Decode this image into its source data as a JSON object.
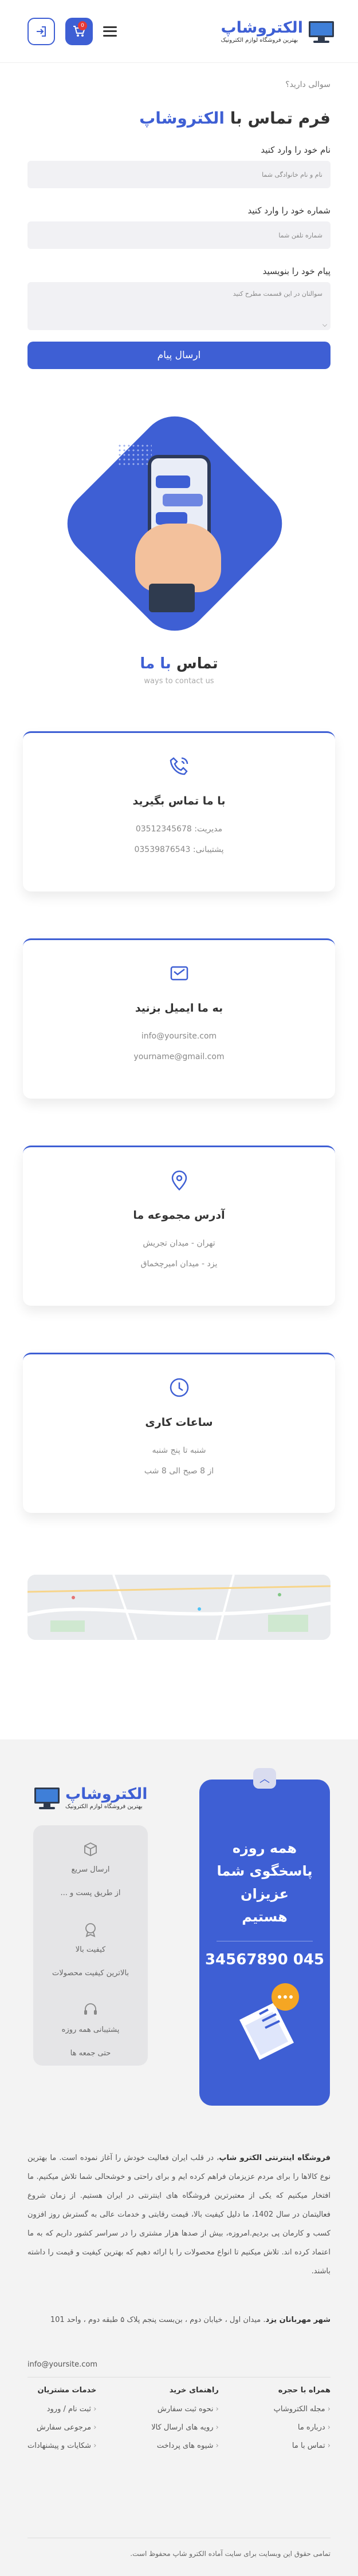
{
  "header": {
    "logo_name": "الکتروشاپ",
    "logo_tagline": "بهترین فروشگاه لوازم الکترونیک",
    "cart_count": "0"
  },
  "form": {
    "question_link": "سوالی دارید؟",
    "title_prefix": "فرم تماس با",
    "title_accent": "الکتروشاپ",
    "name_label": "نام خود را وارد کنید",
    "name_placeholder": "نام و نام خانوادگی شما",
    "phone_label": "شماره خود را وارد کنید",
    "phone_placeholder": "شماره تلفن شما",
    "message_label": "پیام خود را بنویسید",
    "message_placeholder": "سوالتان در این قسمت مطرح کنید",
    "submit_label": "ارسال پیام"
  },
  "contact": {
    "title_prefix": "تماس",
    "title_accent": "با ما",
    "subtitle": "ways to contact us",
    "cards": [
      {
        "icon": "phone-icon",
        "title": "با ما تماس بگیرید",
        "lines": [
          "مدیریت: 03512345678",
          "پشتیبانی: 03539876543"
        ]
      },
      {
        "icon": "email-icon",
        "title": "به ما ایمیل بزنید",
        "lines": [
          "info@yoursite.com",
          "yourname@gmail.com"
        ]
      },
      {
        "icon": "location-icon",
        "title": "آدرس مجموعه ما",
        "lines": [
          "تهران - میدان تجریش",
          "یزد - میدان امیرچخماق"
        ]
      },
      {
        "icon": "clock-icon",
        "title": "ساعات کاری",
        "lines": [
          "شنبه تا پنج شنبه",
          "از 8 صبح الی 8 شب"
        ]
      }
    ]
  },
  "footer": {
    "logo_name": "الکتروشاپ",
    "logo_tagline": "بهترین فروشگاه لوازم الکترونیک",
    "headline": "همه روزه پاسخگوی شما عزیزان هستیم",
    "phone": "045 34567890",
    "features": [
      {
        "icon": "shipping-icon",
        "title": "ارسال سریع",
        "desc": "از طریق پست و ..."
      },
      {
        "icon": "quality-icon",
        "title": "کیفیت بالا",
        "desc": "بالاترین کیفیت محصولات"
      },
      {
        "icon": "support-icon",
        "title": "پشتیبانی همه روزه",
        "desc": "حتی جمعه ها"
      }
    ],
    "about_bold": "فروشگاه اینترنتی الکترو شاپ",
    "about_text": "، در قلب ایران فعالیت خودش را آغاز نموده است. ما بهترین نوع کالاها را برای مردم عزیزمان فراهم کرده ایم و برای راحتی و خوشحالی شما تلاش میکنیم. ما افتخار میکنیم که یکی از معتبرترین فروشگاه های اینترنتی در ایران هستیم. از زمان شروع فعالیتمان در سال 1402، ما دلیل کیفیت بالا، قیمت رقابتی و خدمات عالی به گسترش روز افزون کسب و کارمان پی بردیم.امروزه، بیش از صدها هزار مشتری را در سراسر کشور داریم که به ما اعتماد کرده اند. تلاش میکنیم تا انواع محصولات را با ارائه دهیم که بهترین کیفیت و قیمت را داشته باشند.",
    "address_label": "شهر مهربانان یزد",
    "address_text": ". میدان اول ، خیابان دوم ، بن‌بست پنجم پلاک ۵ طبقه دوم ، واحد 101",
    "email": "info@yoursite.com",
    "columns": [
      {
        "title": "همراه با حجره",
        "items": [
          "مجله الکتروشاپ",
          "درباره ما",
          "تماس با ما"
        ]
      },
      {
        "title": "راهنمای خرید",
        "items": [
          "نحوه ثبت سفارش",
          "رویه های ارسال کالا",
          "شیوه های پرداخت"
        ]
      },
      {
        "title": "خدمات مشتریان",
        "items": [
          "ثبت نام / ورود",
          "مرجوعی سفارش",
          "شکایات و پیشنهادات"
        ]
      }
    ],
    "copyright": "تمامی حقوق این وبسایت برای سایت آماده الکترو شاپ محفوظ است."
  }
}
